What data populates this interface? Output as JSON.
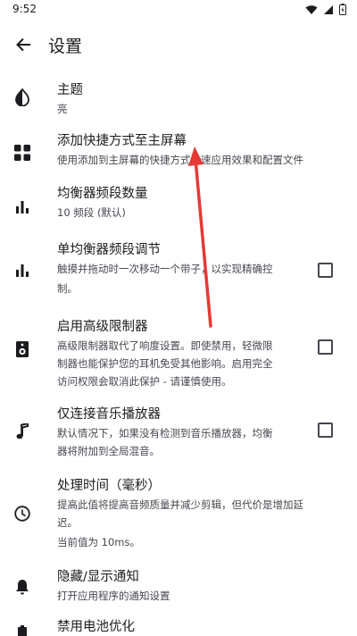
{
  "status_bar": {
    "time": "9:52"
  },
  "app_bar": {
    "title": "设置"
  },
  "settings": [
    {
      "id": "theme",
      "title": "主题",
      "summary": "亮",
      "icon": "theme-contrast-icon",
      "checkbox": false
    },
    {
      "id": "add-shortcut",
      "title": "添加快捷方式至主屏幕",
      "summary": "使用添加到主屏幕的快捷方式快速应用效果和配置文件",
      "icon": "grid-apps-icon",
      "checkbox": false
    },
    {
      "id": "eq-bands",
      "title": "均衡器频段数量",
      "summary": "10 频段 (默认)",
      "icon": "equalizer-bars-icon",
      "checkbox": false
    },
    {
      "id": "single-band",
      "title": "单均衡器频段调节",
      "summary_lines": [
        "触摸并拖动时一次移动一个带子，以实现精确控",
        "制。"
      ],
      "icon": "equalizer-bars-icon",
      "checkbox": true,
      "checked": false
    },
    {
      "id": "advanced-limiter",
      "title": "启用高级限制器",
      "summary_lines": [
        "高级限制器取代了响度设置。即使禁用，轻微限",
        "制器也能保护您的耳机免受其他影响。启用完全",
        "访问权限会取消此保护 - 请谨慎使用。"
      ],
      "icon": "speaker-icon",
      "checkbox": true,
      "checked": false
    },
    {
      "id": "music-only",
      "title": "仅连接音乐播放器",
      "summary_lines": [
        "默认情况下，如果没有检测到音乐播放器，均衡",
        "器将附加到全局混音。"
      ],
      "icon": "music-note-icon",
      "checkbox": true,
      "checked": false
    },
    {
      "id": "processing-time",
      "title": "处理时间（毫秒）",
      "summary_lines": [
        "提高此值将提高音频质量并减少剪辑，但代价是增加延",
        "迟。",
        "当前值为 10ms。"
      ],
      "icon": "clock-icon",
      "checkbox": false
    },
    {
      "id": "notification",
      "title": "隐藏/显示通知",
      "summary": "打开应用程序的通知设置",
      "icon": "bell-icon",
      "checkbox": false
    },
    {
      "id": "battery",
      "title": "禁用电池优化",
      "icon": "battery-icon",
      "checkbox": false
    }
  ],
  "colors": {
    "annotation_arrow": "#e53935",
    "text_primary": "#1c1b1f",
    "text_secondary": "#49454f"
  }
}
